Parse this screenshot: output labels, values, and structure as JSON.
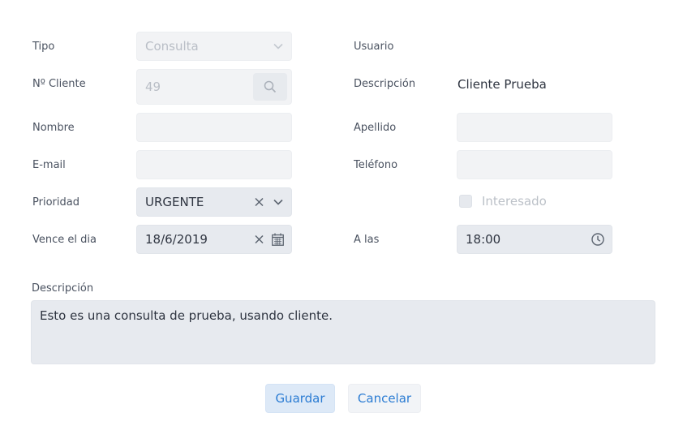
{
  "form": {
    "tipo": {
      "label": "Tipo",
      "value": "Consulta"
    },
    "cliente": {
      "label": "Nº Cliente",
      "value": "49"
    },
    "nombre": {
      "label": "Nombre",
      "value": ""
    },
    "email": {
      "label": "E-mail",
      "value": ""
    },
    "prioridad": {
      "label": "Prioridad",
      "value": "URGENTE"
    },
    "vence": {
      "label": "Vence el dia",
      "value": "18/6/2019"
    },
    "usuario": {
      "label": "Usuario",
      "value": ""
    },
    "descripcion_cliente": {
      "label": "Descripción",
      "value": "Cliente Prueba"
    },
    "apellido": {
      "label": "Apellido",
      "value": ""
    },
    "telefono": {
      "label": "Teléfono",
      "value": ""
    },
    "interesado": {
      "label": "Interesado",
      "checked": false
    },
    "hora": {
      "label": "A las",
      "value": "18:00"
    },
    "descripcion": {
      "label": "Descripción",
      "value": "Esto es una consulta de prueba, usando cliente."
    }
  },
  "buttons": {
    "save": "Guardar",
    "cancel": "Cancelar"
  },
  "colors": {
    "accent": "#2b7cd3",
    "field_bg": "#f2f3f5",
    "field_active_bg": "#e7eaef"
  },
  "icons": [
    "chevron-down-icon",
    "search-icon",
    "clear-icon",
    "calendar-icon",
    "clock-icon",
    "checkbox-icon"
  ]
}
